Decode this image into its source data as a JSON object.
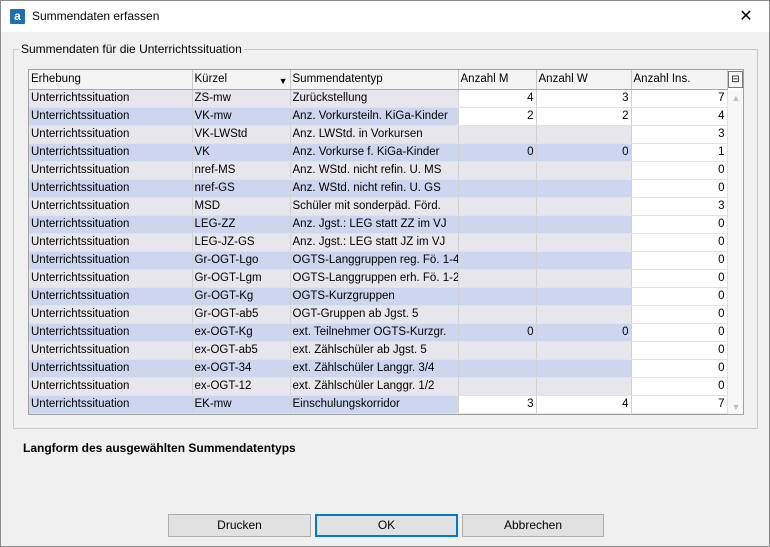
{
  "window": {
    "title": "Summendaten erfassen",
    "app_icon_letter": "a",
    "close_glyph": "✕"
  },
  "group": {
    "legend": "Summendaten für die Unterrichtssituation"
  },
  "grid": {
    "columns": [
      "Erhebung",
      "Kürzel",
      "Summendatentyp",
      "Anzahl M",
      "Anzahl W",
      "Anzahl Ins."
    ],
    "rows": [
      {
        "erhebung": "Unterrichtssituation",
        "kuerzel": "ZS-mw",
        "typ": "Zurückstellung",
        "m": "4",
        "w": "3",
        "ins": "7",
        "m_editable": true,
        "w_editable": true
      },
      {
        "erhebung": "Unterrichtssituation",
        "kuerzel": "VK-mw",
        "typ": "Anz. Vorkursteiln. KiGa-Kinder",
        "m": "2",
        "w": "2",
        "ins": "4",
        "m_editable": true,
        "w_editable": true
      },
      {
        "erhebung": "Unterrichtssituation",
        "kuerzel": "VK-LWStd",
        "typ": "Anz. LWStd. in Vorkursen",
        "m": "",
        "w": "",
        "ins": "3",
        "m_editable": false,
        "w_editable": false
      },
      {
        "erhebung": "Unterrichtssituation",
        "kuerzel": "VK",
        "typ": "Anz. Vorkurse f. KiGa-Kinder",
        "m": "0",
        "w": "0",
        "ins": "1",
        "m_editable": false,
        "w_editable": false
      },
      {
        "erhebung": "Unterrichtssituation",
        "kuerzel": "nref-MS",
        "typ": "Anz. WStd. nicht refin. U. MS",
        "m": "",
        "w": "",
        "ins": "0",
        "m_editable": false,
        "w_editable": false
      },
      {
        "erhebung": "Unterrichtssituation",
        "kuerzel": "nref-GS",
        "typ": "Anz. WStd. nicht refin. U. GS",
        "m": "",
        "w": "",
        "ins": "0",
        "m_editable": false,
        "w_editable": false
      },
      {
        "erhebung": "Unterrichtssituation",
        "kuerzel": "MSD",
        "typ": "Schüler mit sonderpäd. Förd.",
        "m": "",
        "w": "",
        "ins": "3",
        "m_editable": false,
        "w_editable": false
      },
      {
        "erhebung": "Unterrichtssituation",
        "kuerzel": "LEG-ZZ",
        "typ": "Anz. Jgst.: LEG statt ZZ im VJ",
        "m": "",
        "w": "",
        "ins": "0",
        "m_editable": false,
        "w_editable": false
      },
      {
        "erhebung": "Unterrichtssituation",
        "kuerzel": "LEG-JZ-GS",
        "typ": "Anz. Jgst.: LEG statt JZ im VJ",
        "m": "",
        "w": "",
        "ins": "0",
        "m_editable": false,
        "w_editable": false
      },
      {
        "erhebung": "Unterrichtssituation",
        "kuerzel": "Gr-OGT-Lgo",
        "typ": "OGTS-Langgruppen reg. Fö. 1-4",
        "m": "",
        "w": "",
        "ins": "0",
        "m_editable": false,
        "w_editable": false
      },
      {
        "erhebung": "Unterrichtssituation",
        "kuerzel": "Gr-OGT-Lgm",
        "typ": "OGTS-Langgruppen erh. Fö. 1-2",
        "m": "",
        "w": "",
        "ins": "0",
        "m_editable": false,
        "w_editable": false
      },
      {
        "erhebung": "Unterrichtssituation",
        "kuerzel": "Gr-OGT-Kg",
        "typ": "OGTS-Kurzgruppen",
        "m": "",
        "w": "",
        "ins": "0",
        "m_editable": false,
        "w_editable": false
      },
      {
        "erhebung": "Unterrichtssituation",
        "kuerzel": "Gr-OGT-ab5",
        "typ": "OGT-Gruppen ab Jgst. 5",
        "m": "",
        "w": "",
        "ins": "0",
        "m_editable": false,
        "w_editable": false
      },
      {
        "erhebung": "Unterrichtssituation",
        "kuerzel": "ex-OGT-Kg",
        "typ": "ext. Teilnehmer OGTS-Kurzgr.",
        "m": "0",
        "w": "0",
        "ins": "0",
        "m_editable": false,
        "w_editable": false
      },
      {
        "erhebung": "Unterrichtssituation",
        "kuerzel": "ex-OGT-ab5",
        "typ": "ext. Zählschüler ab Jgst. 5",
        "m": "",
        "w": "",
        "ins": "0",
        "m_editable": false,
        "w_editable": false
      },
      {
        "erhebung": "Unterrichtssituation",
        "kuerzel": "ex-OGT-34",
        "typ": "ext. Zählschüler Langgr. 3/4",
        "m": "",
        "w": "",
        "ins": "0",
        "m_editable": false,
        "w_editable": false
      },
      {
        "erhebung": "Unterrichtssituation",
        "kuerzel": "ex-OGT-12",
        "typ": "ext. Zählschüler Langgr. 1/2",
        "m": "",
        "w": "",
        "ins": "0",
        "m_editable": false,
        "w_editable": false
      },
      {
        "erhebung": "Unterrichtssituation",
        "kuerzel": "EK-mw",
        "typ": "Einschulungskorridor",
        "m": "3",
        "w": "4",
        "ins": "7",
        "m_editable": true,
        "w_editable": true
      }
    ]
  },
  "longform": {
    "label": "Langform des ausgewählten Summendatentyps"
  },
  "buttons": {
    "print": "Drucken",
    "ok": "OK",
    "cancel": "Abbrechen"
  }
}
